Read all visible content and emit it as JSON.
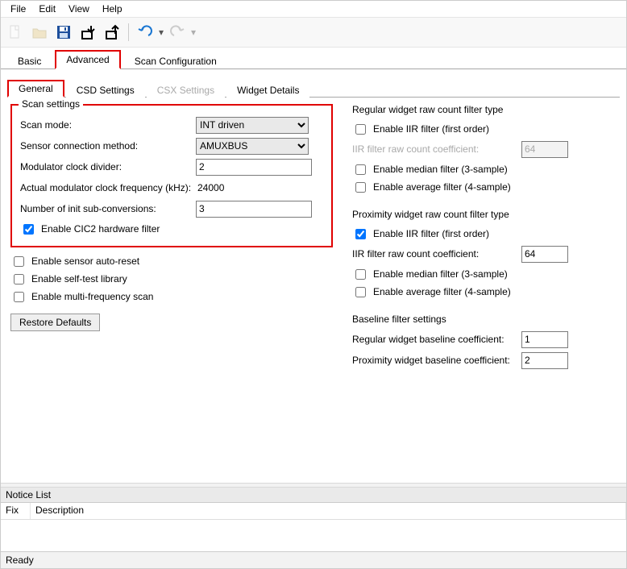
{
  "menu": {
    "file": "File",
    "edit": "Edit",
    "view": "View",
    "help": "Help"
  },
  "outer_tabs": {
    "basic": "Basic",
    "advanced": "Advanced",
    "scan_config": "Scan Configuration"
  },
  "inner_tabs": {
    "general": "General",
    "csd": "CSD Settings",
    "csx": "CSX Settings",
    "widget": "Widget Details"
  },
  "scan_settings": {
    "title": "Scan settings",
    "scan_mode_lbl": "Scan mode:",
    "scan_mode_val": "INT driven",
    "sensor_conn_lbl": "Sensor connection method:",
    "sensor_conn_val": "AMUXBUS",
    "mod_div_lbl": "Modulator clock divider:",
    "mod_div_val": "2",
    "actual_freq_lbl": "Actual modulator clock frequency (kHz):",
    "actual_freq_val": "24000",
    "init_sub_lbl": "Number of init sub-conversions:",
    "init_sub_val": "3",
    "cic2_lbl": "Enable CIC2 hardware filter"
  },
  "left_checks": {
    "auto_reset": "Enable sensor auto-reset",
    "self_test": "Enable self-test library",
    "multi_freq": "Enable multi-frequency scan"
  },
  "restore": "Restore Defaults",
  "regular_filter": {
    "title": "Regular widget raw count filter type",
    "iir": "Enable IIR filter (first order)",
    "coef_lbl": "IIR filter raw count coefficient:",
    "coef_val": "64",
    "median": "Enable median filter (3-sample)",
    "avg": "Enable average filter (4-sample)"
  },
  "prox_filter": {
    "title": "Proximity widget raw count filter type",
    "iir": "Enable IIR filter (first order)",
    "coef_lbl": "IIR filter raw count coefficient:",
    "coef_val": "64",
    "median": "Enable median filter (3-sample)",
    "avg": "Enable average filter (4-sample)"
  },
  "baseline": {
    "title": "Baseline filter settings",
    "reg_lbl": "Regular widget baseline coefficient:",
    "reg_val": "1",
    "prox_lbl": "Proximity widget baseline coefficient:",
    "prox_val": "2"
  },
  "notice": {
    "header": "Notice List",
    "fix": "Fix",
    "desc": "Description"
  },
  "status": "Ready"
}
